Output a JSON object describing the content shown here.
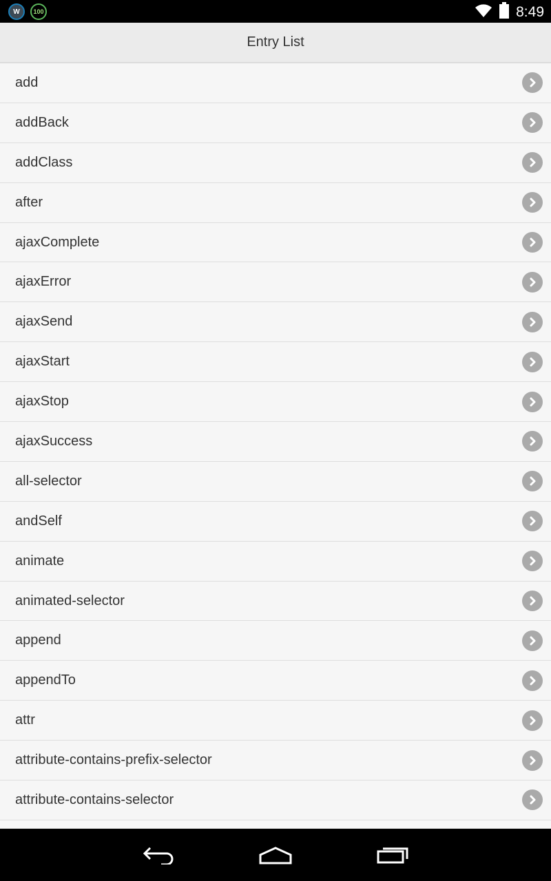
{
  "status_bar": {
    "notifications": [
      {
        "icon": "wordpress-icon",
        "text": "W"
      },
      {
        "icon": "battery-widget-icon",
        "text": "100"
      }
    ],
    "time": "8:49"
  },
  "header": {
    "title": "Entry List"
  },
  "entries": [
    {
      "label": "add"
    },
    {
      "label": "addBack"
    },
    {
      "label": "addClass"
    },
    {
      "label": "after"
    },
    {
      "label": "ajaxComplete"
    },
    {
      "label": "ajaxError"
    },
    {
      "label": "ajaxSend"
    },
    {
      "label": "ajaxStart"
    },
    {
      "label": "ajaxStop"
    },
    {
      "label": "ajaxSuccess"
    },
    {
      "label": "all-selector"
    },
    {
      "label": "andSelf"
    },
    {
      "label": "animate"
    },
    {
      "label": "animated-selector"
    },
    {
      "label": "append"
    },
    {
      "label": "appendTo"
    },
    {
      "label": "attr"
    },
    {
      "label": "attribute-contains-prefix-selector"
    },
    {
      "label": "attribute-contains-selector"
    },
    {
      "label": ""
    }
  ],
  "nav_bar": {
    "buttons": [
      "back-icon",
      "home-icon",
      "recent-apps-icon"
    ]
  },
  "colors": {
    "header_bg": "#ebebeb",
    "list_bg": "#f6f6f6",
    "arrow_bg": "#aaaaaa",
    "text": "#333333"
  }
}
